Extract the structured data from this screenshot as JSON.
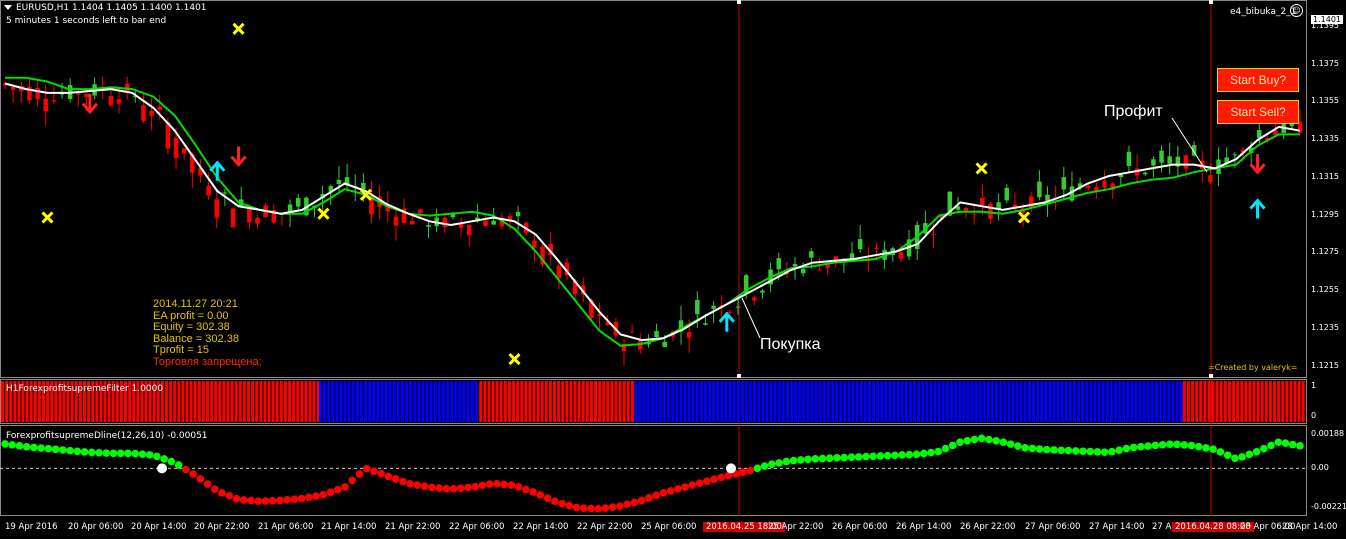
{
  "header": {
    "symbol_line": "EURUSD,H1  1.1404 1.1405 1.1400 1.1401",
    "timer_text": "5 minutes 1 seconds left to bar end",
    "ea_name": "e4_bibuka_2_1"
  },
  "ea_info": {
    "datetime": "2014.11.27 20:21",
    "ea_profit": "EA profit = 0.00",
    "equity": "Equity = 302.38",
    "balance": "Balance = 302.38",
    "tprofit": "Tprofit = 15",
    "status": "Торговля запрещена;"
  },
  "buttons": {
    "buy": "Start Buy?",
    "sell": "Start Sell?"
  },
  "annotations": {
    "profit": "Профит",
    "buy": "Покупка",
    "credit": "=Created by valeryk="
  },
  "indicators": {
    "filter_label": "H1ForexprofitsupremeFilter 1.0000",
    "dline_label": "ForexprofitsupremeDline(12,26,10) -0.00051"
  },
  "colors": {
    "bull": "#32cd32",
    "bear": "#ff0000",
    "fast_ma": "#ffffff",
    "slow_ma": "#00dd00",
    "filter_red": "#ff0000",
    "filter_blue": "#0000ff",
    "arrow_up": "#00e5ff",
    "arrow_down": "#ff2020",
    "cross": "#ffff00",
    "ea_text": "#e6c200"
  },
  "price_axis": {
    "labels": [
      "1.1401",
      "1.1395",
      "1.1375",
      "1.1355",
      "1.1335",
      "1.1315",
      "1.1295",
      "1.1275",
      "1.1255",
      "1.1235",
      "1.1215"
    ]
  },
  "filter_axis": {
    "labels": [
      "1",
      "0"
    ]
  },
  "dline_axis": {
    "labels": [
      "0.00188",
      "0.00",
      "-0.00221"
    ]
  },
  "time_axis": {
    "labels": [
      "19 Apr 2016",
      "20 Apr 06:00",
      "20 Apr 14:00",
      "20 Apr 22:00",
      "21 Apr 06:00",
      "21 Apr 14:00",
      "21 Apr 22:00",
      "22 Apr 06:00",
      "22 Apr 14:00",
      "22 Apr 22:00",
      "25 Apr 06:00",
      "2016.04.25 18:00",
      "25 Apr 22:00",
      "26 Apr 06:00",
      "26 Apr 14:00",
      "26 Apr 22:00",
      "27 Apr 06:00",
      "27 Apr 14:00",
      "27 Apr",
      "2016.04.28 08:00",
      "28 Apr 06:00",
      "28 Apr 14:00"
    ]
  },
  "chart_data": [
    {
      "type": "candlestick",
      "title": "EURUSD,H1",
      "ylim": [
        1.121,
        1.1405
      ],
      "fast_ma": [
        1.1365,
        1.1362,
        1.136,
        1.136,
        1.1361,
        1.1362,
        1.136,
        1.1352,
        1.134,
        1.1324,
        1.1308,
        1.13,
        1.1298,
        1.1296,
        1.1298,
        1.1305,
        1.1312,
        1.1308,
        1.1301,
        1.1296,
        1.1292,
        1.129,
        1.1292,
        1.1294,
        1.1292,
        1.1285,
        1.1272,
        1.1258,
        1.1244,
        1.1232,
        1.1229,
        1.123,
        1.1235,
        1.1242,
        1.1248,
        1.1254,
        1.126,
        1.1266,
        1.127,
        1.1271,
        1.1272,
        1.1274,
        1.1276,
        1.128,
        1.1292,
        1.1302,
        1.13,
        1.1298,
        1.13,
        1.1302,
        1.1306,
        1.1312,
        1.1316,
        1.1318,
        1.132,
        1.1322,
        1.1322,
        1.132,
        1.1325,
        1.1335,
        1.1342,
        1.134
      ],
      "slow_ma": [
        1.1368,
        1.1368,
        1.1366,
        1.1362,
        1.1362,
        1.1363,
        1.1362,
        1.1358,
        1.1348,
        1.1332,
        1.1315,
        1.1302,
        1.1298,
        1.1296,
        1.1296,
        1.1302,
        1.1309,
        1.1306,
        1.13,
        1.1296,
        1.1295,
        1.1296,
        1.1297,
        1.1295,
        1.1288,
        1.1276,
        1.1262,
        1.1248,
        1.1234,
        1.1226,
        1.1227,
        1.123,
        1.1236,
        1.1242,
        1.1248,
        1.1256,
        1.1262,
        1.1267,
        1.1268,
        1.127,
        1.1271,
        1.1272,
        1.1276,
        1.1284,
        1.1295,
        1.1297,
        1.1297,
        1.1296,
        1.1298,
        1.1301,
        1.1304,
        1.1307,
        1.1309,
        1.1312,
        1.1314,
        1.1315,
        1.1318,
        1.132,
        1.1322,
        1.1332,
        1.1338,
        1.1338
      ],
      "buy_arrows": [
        {
          "i": 10,
          "price": 1.1323
        },
        {
          "i": 34,
          "price": 1.1243
        },
        {
          "i": 59,
          "price": 1.1303
        }
      ],
      "sell_arrows": [
        {
          "i": 4,
          "price": 1.135
        },
        {
          "i": 11,
          "price": 1.1322
        },
        {
          "i": 59,
          "price": 1.1318
        }
      ],
      "exit_marks": [
        {
          "i": 2,
          "price": 1.1294
        },
        {
          "i": 11,
          "price": 1.1394
        },
        {
          "i": 15,
          "price": 1.1296
        },
        {
          "i": 17,
          "price": 1.1306
        },
        {
          "i": 24,
          "price": 1.1219
        },
        {
          "i": 46,
          "price": 1.132
        },
        {
          "i": 48,
          "price": 1.1294
        }
      ]
    },
    {
      "type": "bar",
      "title": "H1ForexprofitsupremeFilter",
      "segments": [
        {
          "color": "red",
          "from": 0.0,
          "to": 0.244
        },
        {
          "color": "blue",
          "from": 0.244,
          "to": 0.367
        },
        {
          "color": "red",
          "from": 0.367,
          "to": 0.486
        },
        {
          "color": "blue",
          "from": 0.486,
          "to": 0.907
        },
        {
          "color": "red",
          "from": 0.907,
          "to": 1.0
        }
      ],
      "ylim": [
        0,
        1
      ]
    },
    {
      "type": "line",
      "title": "ForexprofitsupremeDline(12,26,10)",
      "ylim": [
        -0.00221,
        0.00188
      ],
      "values": [
        0.0013,
        0.00115,
        0.00105,
        0.00095,
        0.00085,
        0.0008,
        0.0008,
        0.0007,
        0.0003,
        -0.0004,
        -0.0012,
        -0.00165,
        -0.00175,
        -0.0017,
        -0.0016,
        -0.0014,
        -0.001,
        0.0,
        -0.0004,
        -0.0008,
        -0.001,
        -0.0011,
        -0.001,
        -0.0008,
        -0.0009,
        -0.0013,
        -0.0018,
        -0.0021,
        -0.00215,
        -0.002,
        -0.0017,
        -0.0013,
        -0.001,
        -0.0007,
        -0.0004,
        -0.00015,
        0.0002,
        0.0004,
        0.0005,
        0.00055,
        0.0006,
        0.00065,
        0.0007,
        0.00075,
        0.0009,
        0.0014,
        0.0016,
        0.0014,
        0.0011,
        0.001,
        0.00095,
        0.0009,
        0.00085,
        0.0011,
        0.0012,
        0.0013,
        0.0012,
        0.001,
        0.0005,
        0.0009,
        0.0014,
        0.0012
      ]
    }
  ]
}
